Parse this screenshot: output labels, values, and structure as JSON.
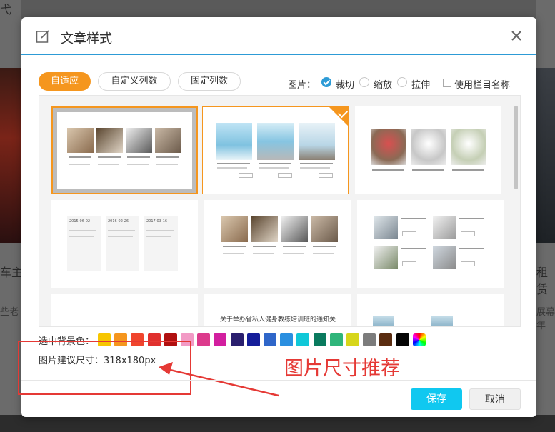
{
  "background": {
    "left_heading": "车主",
    "left_sub": "些老",
    "left_top": "弋",
    "right_heading": "租赁",
    "right_sub": "展幕年"
  },
  "dialog": {
    "title": "文章样式",
    "tabs": [
      {
        "label": "自适应",
        "active": true
      },
      {
        "label": "自定义列数",
        "active": false
      },
      {
        "label": "固定列数",
        "active": false
      }
    ],
    "image_label": "图片：",
    "image_modes": [
      {
        "label": "裁切",
        "selected": true
      },
      {
        "label": "缩放",
        "selected": false
      },
      {
        "label": "拉伸",
        "selected": false
      }
    ],
    "use_column_name_label": "使用栏目名称",
    "bg_color_label": "选中背景色：",
    "swatches": [
      "#f7c600",
      "#f5961e",
      "#f0452d",
      "#e0302e",
      "#b01010",
      "#f29ac5",
      "#dc3a8c",
      "#d21f9f",
      "#2a1f6e",
      "#151e9a",
      "#2f66c9",
      "#2a8fe0",
      "#10c8d8",
      "#0a7a5e",
      "#2fb57a",
      "#d7d61b",
      "#7c7c7c",
      "#5a2c10",
      "#050505",
      "rainbow"
    ],
    "size_hint": "图片建议尺寸：318x180px",
    "save_label": "保存",
    "cancel_label": "取消"
  },
  "cards": {
    "date1": "2015-06-02",
    "date2": "2016-02-26",
    "date3": "2017-03-16",
    "notice": "关于举办省私人健身教练培训班的通知关"
  },
  "annotation": {
    "text": "图片尺寸推荐",
    "color": "#e53935"
  }
}
